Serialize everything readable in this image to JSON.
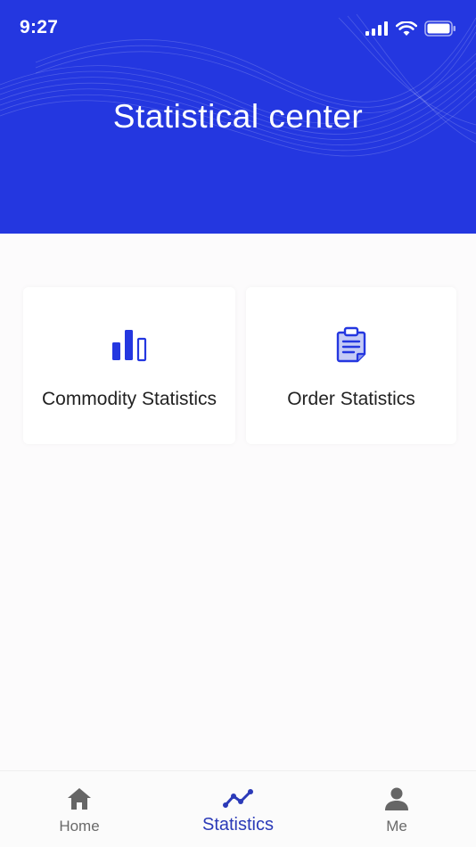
{
  "status_bar": {
    "time": "9:27",
    "icons": [
      "signal-icon",
      "wifi-icon",
      "battery-icon"
    ]
  },
  "header": {
    "title": "Statistical center",
    "background_color": "#2437e0"
  },
  "cards": [
    {
      "label": "Commodity Statistics",
      "icon": "bar-chart-icon"
    },
    {
      "label": "Order Statistics",
      "icon": "clipboard-icon"
    }
  ],
  "tabbar": {
    "tabs": [
      {
        "label": "Home",
        "icon": "home-icon",
        "active": false
      },
      {
        "label": "Statistics",
        "icon": "trend-line-icon",
        "active": true
      },
      {
        "label": "Me",
        "icon": "person-icon",
        "active": false
      }
    ],
    "active_color": "#2b3ab8",
    "inactive_color": "#6a6a6a"
  },
  "accent_color": "#2437e0"
}
